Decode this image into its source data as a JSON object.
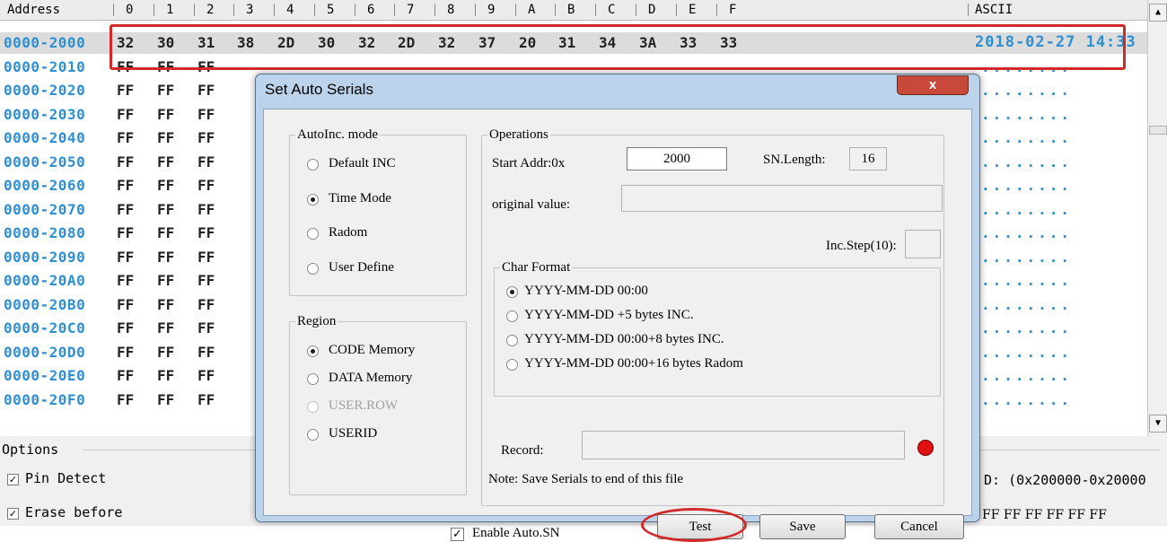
{
  "hex": {
    "header": {
      "address": "Address",
      "cols": [
        "0",
        "1",
        "2",
        "3",
        "4",
        "5",
        "6",
        "7",
        "8",
        "9",
        "A",
        "B",
        "C",
        "D",
        "E",
        "F"
      ],
      "ascii": "ASCII"
    },
    "rows": [
      {
        "addr": "0000-2000",
        "bytes": [
          "32",
          "30",
          "31",
          "38",
          "2D",
          "30",
          "32",
          "2D",
          "32",
          "37",
          "20",
          "31",
          "34",
          "3A",
          "33",
          "33"
        ],
        "ascii": "2018-02-27 14:33"
      },
      {
        "addr": "0000-2010",
        "bytes": [
          "FF",
          "FF",
          "FF"
        ]
      },
      {
        "addr": "0000-2020",
        "bytes": [
          "FF",
          "FF",
          "FF"
        ]
      },
      {
        "addr": "0000-2030",
        "bytes": [
          "FF",
          "FF",
          "FF"
        ]
      },
      {
        "addr": "0000-2040",
        "bytes": [
          "FF",
          "FF",
          "FF"
        ]
      },
      {
        "addr": "0000-2050",
        "bytes": [
          "FF",
          "FF",
          "FF"
        ]
      },
      {
        "addr": "0000-2060",
        "bytes": [
          "FF",
          "FF",
          "FF"
        ]
      },
      {
        "addr": "0000-2070",
        "bytes": [
          "FF",
          "FF",
          "FF"
        ]
      },
      {
        "addr": "0000-2080",
        "bytes": [
          "FF",
          "FF",
          "FF"
        ]
      },
      {
        "addr": "0000-2090",
        "bytes": [
          "FF",
          "FF",
          "FF"
        ]
      },
      {
        "addr": "0000-20A0",
        "bytes": [
          "FF",
          "FF",
          "FF"
        ]
      },
      {
        "addr": "0000-20B0",
        "bytes": [
          "FF",
          "FF",
          "FF"
        ]
      },
      {
        "addr": "0000-20C0",
        "bytes": [
          "FF",
          "FF",
          "FF"
        ]
      },
      {
        "addr": "0000-20D0",
        "bytes": [
          "FF",
          "FF",
          "FF"
        ]
      },
      {
        "addr": "0000-20E0",
        "bytes": [
          "FF",
          "FF",
          "FF"
        ]
      },
      {
        "addr": "0000-20F0",
        "bytes": [
          "FF",
          "FF",
          "FF"
        ]
      }
    ],
    "dots": "........"
  },
  "options": {
    "label": "Options",
    "pin_detect": "Pin Detect",
    "erase_before": "Erase before",
    "range_text": "D: (0x200000-0x20000",
    "ff_text": "FF FF FF FF FF FF"
  },
  "dialog": {
    "title": "Set Auto Serials",
    "close": "x",
    "autoinc": {
      "legend": "AutoInc. mode",
      "items": [
        "Default INC",
        "Time Mode",
        "Radom",
        "User Define"
      ],
      "selected": 1
    },
    "region": {
      "legend": "Region",
      "items": [
        "CODE Memory",
        "DATA Memory",
        "USER.ROW",
        "USERID"
      ],
      "selected": 0,
      "disabled": [
        2
      ]
    },
    "operations": {
      "legend": "Operations",
      "start_addr_label": "Start Addr:0x",
      "start_addr_value": "2000",
      "sn_length_label": "SN.Length:",
      "sn_length_value": "16",
      "original_value_label": "original value:",
      "original_value": "",
      "inc_step_label": "Inc.Step(10):",
      "inc_step_value": ""
    },
    "char_format": {
      "legend": "Char Format",
      "items": [
        "YYYY-MM-DD 00:00",
        "YYYY-MM-DD +5 bytes INC.",
        "YYYY-MM-DD 00:00+8 bytes INC.",
        "YYYY-MM-DD 00:00+16 bytes Radom"
      ],
      "selected": 0
    },
    "record_label": "Record:",
    "record_value": "",
    "note": "Note: Save Serials to end of this file",
    "enable_auto_sn": "Enable Auto.SN",
    "enable_checked": true,
    "buttons": {
      "test": "Test",
      "save": "Save",
      "cancel": "Cancel"
    }
  },
  "colors": {
    "accent": "#2f8fd0",
    "highlight": "#d22a2a",
    "dialog_frame": "#bcd3ec"
  }
}
